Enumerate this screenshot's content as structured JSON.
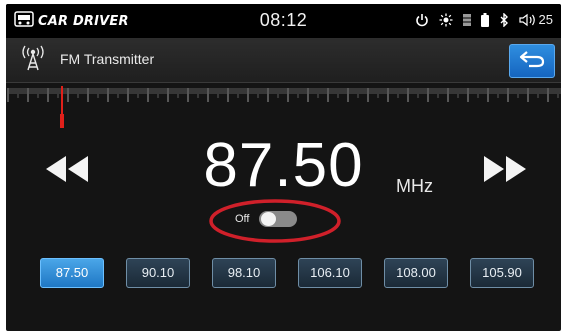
{
  "status_bar": {
    "logo_text": "CAR DRIVER",
    "time": "08:12",
    "volume": "25",
    "icons": [
      "power-icon",
      "brightness-icon",
      "signal-icon",
      "battery-icon",
      "bluetooth-icon",
      "volume-icon"
    ]
  },
  "header": {
    "title": "FM Transmitter",
    "icon": "antenna-icon",
    "back_icon": "back-arrow-icon"
  },
  "tuner": {
    "frequency": "87.50",
    "unit": "MHz",
    "indicator_position": 0.0
  },
  "transmitter_toggle": {
    "label": "Off",
    "state": false
  },
  "presets": [
    {
      "label": "87.50",
      "active": true
    },
    {
      "label": "90.10",
      "active": false
    },
    {
      "label": "98.10",
      "active": false
    },
    {
      "label": "106.10",
      "active": false
    },
    {
      "label": "108.00",
      "active": false
    },
    {
      "label": "105.90",
      "active": false
    }
  ],
  "colors": {
    "background": "#141414",
    "accent_blue": "#1f77c4",
    "indicator_red": "#e0201a",
    "highlight_ring": "#d0202a"
  }
}
